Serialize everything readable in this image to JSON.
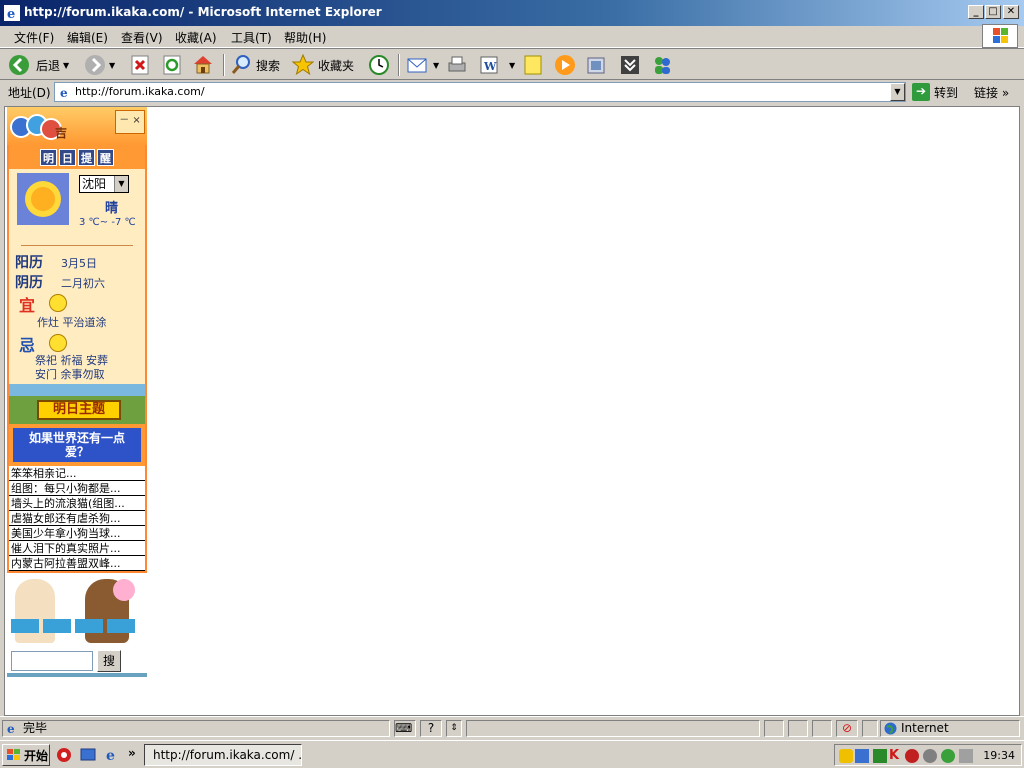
{
  "window": {
    "title": "http://forum.ikaka.com/ - Microsoft Internet Explorer",
    "min_label": "_",
    "max_label": "□",
    "close_label": "✕"
  },
  "menu": [
    "文件(F)",
    "编辑(E)",
    "查看(V)",
    "收藏(A)",
    "工具(T)",
    "帮助(H)"
  ],
  "toolbar": {
    "back_label": "后退",
    "search_label": "搜索",
    "favorites_label": "收藏夹"
  },
  "address": {
    "label": "地址(D)",
    "url": "http://forum.ikaka.com/",
    "go_label": "转到",
    "links_label": "链接",
    "links_chevron": "»"
  },
  "widget": {
    "ctrl": "－ ×",
    "remind_chars": [
      "明",
      "日",
      "提",
      "醒"
    ],
    "city": "沈阳",
    "weather": "晴",
    "temp": "3 ℃~ -7 ℃",
    "solar_label": "阳历",
    "solar_value": "3月5日",
    "lunar_label": "阴历",
    "lunar_value": "二月初六",
    "yi_label": "宜",
    "yi_text": "作灶  平治道涂",
    "ji_label": "忌",
    "ji_text_1": "祭祀  祈福  安葬",
    "ji_text_2": "安门  余事勿取",
    "tomorrow_label": "明日主题",
    "topic": "如果世界还有一点爱？",
    "news": [
      "笨笨相亲记...",
      "组图：每只小狗都是...",
      "墙头上的流浪猫(组图...",
      "虐猫女郎还有虐杀狗...",
      "美国少年拿小狗当球...",
      "催人泪下的真实照片...",
      "内蒙古阿拉善盟双峰..."
    ],
    "search_btn": "搜"
  },
  "status": {
    "text": "完毕",
    "zone": "Internet"
  },
  "taskbar": {
    "start_label": "开始",
    "more": "»",
    "task_label": "http://forum.ikaka.com/ ...",
    "time": "19:34"
  },
  "colors": {
    "titlebar": "#0a246a",
    "widget_orange": "#ff9933",
    "widget_blue": "#2e52c8",
    "text_blue": "#203a80"
  }
}
